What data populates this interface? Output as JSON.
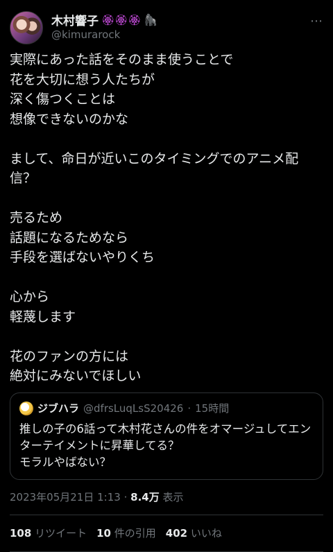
{
  "tweet": {
    "author": {
      "display_name": "木村響子",
      "name_emojis": "🏵🏵🏵",
      "name_emoji_extra": "🦍",
      "handle": "@kimurarock",
      "avatar_icon": "profile-photo"
    },
    "more_icon": "⋯",
    "text": "実際にあった話をそのまま使うことで\n花を大切に想う人たちが\n深く傷つくことは\n想像できないのかな\n\nまして、命日が近いこのタイミングでのアニメ配信？\n\n売るため\n話題になるためなら\n手段を選ばないやりくち\n\n心から\n軽蔑します\n\n花のファンの方には\n絶対にみないでほしい",
    "quoted": {
      "display_name": "ジブハラ",
      "handle": "@dfrsLuqLsS20426",
      "separator": "·",
      "time": "15時間",
      "text": "推しの子の6話って木村花さんの件をオマージュしてエンターテイメントに昇華してる？\nモラルやばない？"
    },
    "timestamp": {
      "date": "2023年05月21日 1:13",
      "separator": "·",
      "views_count": "8.4万",
      "views_label": "表示"
    },
    "stats": {
      "retweets_count": "108",
      "retweets_label": "リツイート",
      "quotes_count": "10",
      "quotes_label": "件の引用",
      "likes_count": "402",
      "likes_label": "いいね"
    }
  }
}
